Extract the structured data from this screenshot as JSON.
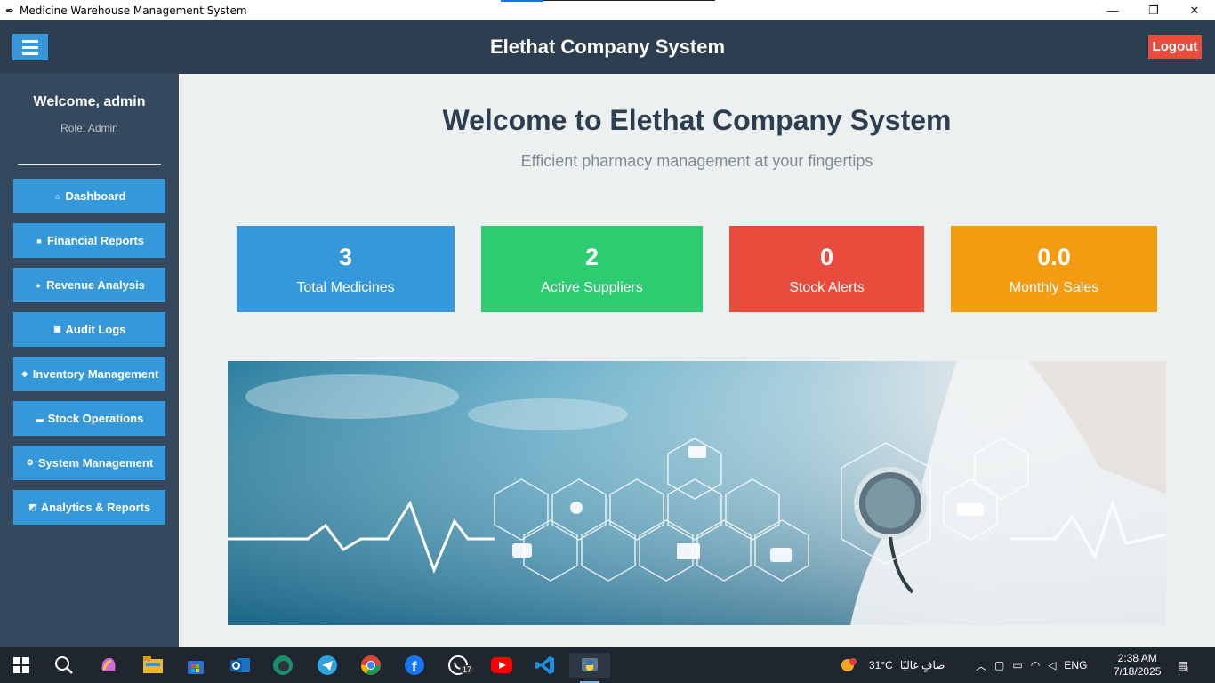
{
  "window": {
    "title": "Medicine Warehouse Management System",
    "controls": [
      "—",
      "❐",
      "✕"
    ]
  },
  "header": {
    "title": "Elethat Company System",
    "logout_label": "Logout"
  },
  "sidebar": {
    "welcome": "Welcome, admin",
    "role": "Role: Admin",
    "items": [
      {
        "label": "Dashboard",
        "icon": "home-icon"
      },
      {
        "label": "Financial Reports",
        "icon": "money-icon"
      },
      {
        "label": "Revenue Analysis",
        "icon": "money-bag-icon"
      },
      {
        "label": "Audit Logs",
        "icon": "clipboard-icon"
      },
      {
        "label": "Inventory Management",
        "icon": "box-icon"
      },
      {
        "label": "Stock Operations",
        "icon": "truck-icon"
      },
      {
        "label": "System Management",
        "icon": "gear-icon"
      },
      {
        "label": "Analytics & Reports",
        "icon": "chart-icon"
      }
    ]
  },
  "main": {
    "title": "Welcome to Elethat Company System",
    "subtitle": "Efficient pharmacy management at your fingertips",
    "cards": [
      {
        "value": "3",
        "label": "Total Medicines",
        "color": "#3498db"
      },
      {
        "value": "2",
        "label": "Active Suppliers",
        "color": "#2ecc71"
      },
      {
        "value": "0",
        "label": "Stock Alerts",
        "color": "#e74c3c"
      },
      {
        "value": "0.0",
        "label": "Monthly Sales",
        "color": "#f39c12"
      }
    ]
  },
  "taskbar": {
    "weather_temp": "31°C",
    "weather_text": "صافٍ غالبًا",
    "weather_badge": "1",
    "language": "ENG",
    "time": "2:38 AM",
    "date": "7/18/2025",
    "whatsapp_badge": "17",
    "notifications_badge": "4"
  }
}
